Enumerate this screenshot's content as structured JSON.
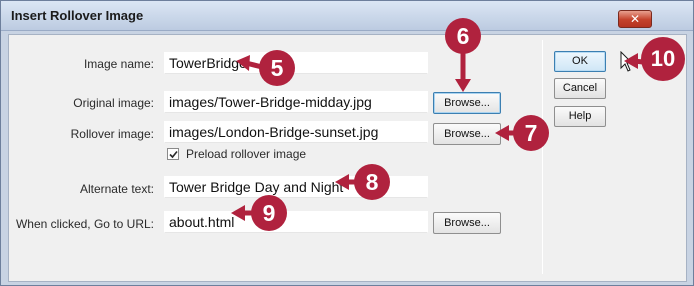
{
  "window": {
    "title": "Insert Rollover Image",
    "close_glyph": "✕"
  },
  "form": {
    "image_name": {
      "label": "Image name:",
      "value": "TowerBridge"
    },
    "original_image": {
      "label": "Original image:",
      "value": "images/Tower-Bridge-midday.jpg",
      "browse_label": "Browse..."
    },
    "rollover_image": {
      "label": "Rollover image:",
      "value": "images/London-Bridge-sunset.jpg",
      "browse_label": "Browse..."
    },
    "preload": {
      "label": "Preload rollover image",
      "checked": true
    },
    "alternate_text": {
      "label": "Alternate text:",
      "value": "Tower Bridge Day and Night"
    },
    "url": {
      "label": "When clicked, Go to URL:",
      "value": "about.html",
      "browse_label": "Browse..."
    }
  },
  "buttons": {
    "ok": "OK",
    "cancel": "Cancel",
    "help": "Help"
  },
  "callouts": [
    "5",
    "6",
    "7",
    "8",
    "9",
    "10"
  ],
  "colors": {
    "callout": "#b0223e",
    "title_bar": "#bccbe1",
    "dialog_bg": "#f0f0f0"
  },
  "icons": {
    "close": "close-icon",
    "check": "checkmark-icon",
    "cursor": "mouse-pointer-icon"
  }
}
